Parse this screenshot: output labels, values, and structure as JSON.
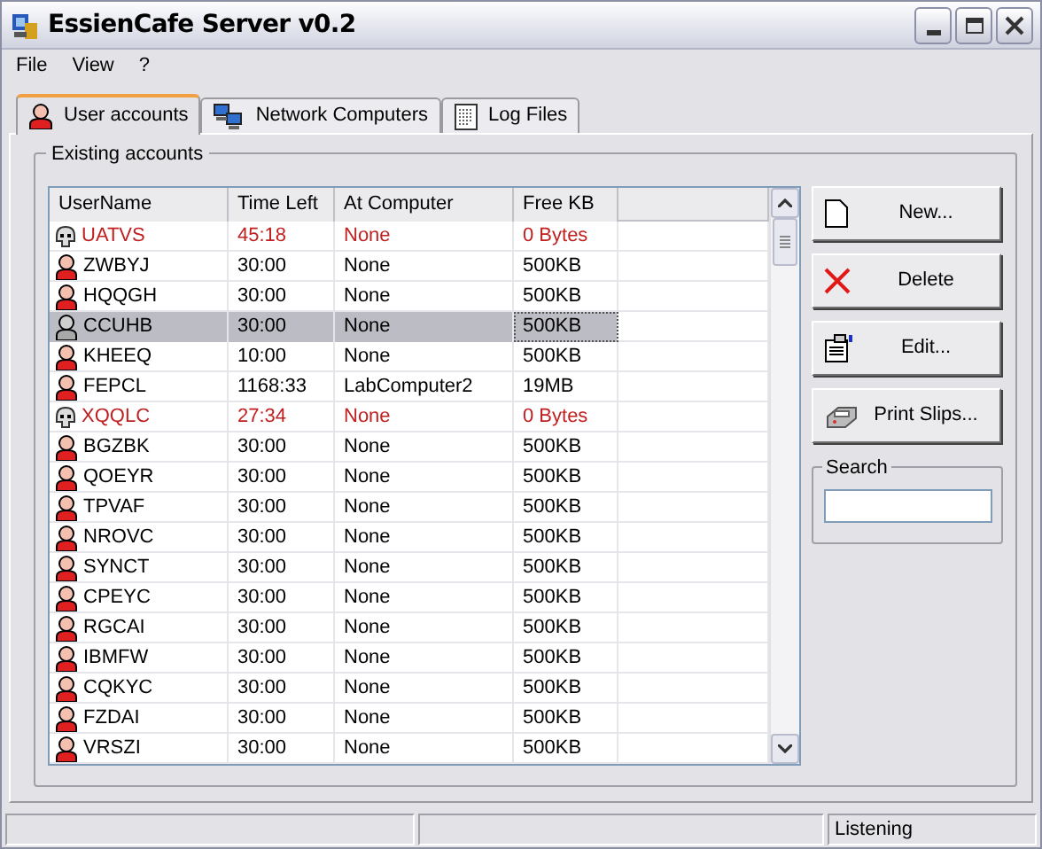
{
  "window": {
    "title": "EssienCafe Server v0.2"
  },
  "menu": [
    "File",
    "View",
    "?"
  ],
  "tabs": [
    {
      "label": "User accounts",
      "selected": true
    },
    {
      "label": "Network Computers",
      "selected": false
    },
    {
      "label": "Log Files",
      "selected": false
    }
  ],
  "group": {
    "title": "Existing accounts"
  },
  "table": {
    "columns": [
      "UserName",
      "Time Left",
      "At Computer",
      "Free KB"
    ],
    "rows": [
      {
        "kind": "expired",
        "selected": false,
        "cells": [
          "UATVS",
          "45:18",
          "None",
          "0 Bytes"
        ]
      },
      {
        "kind": "active",
        "selected": false,
        "cells": [
          "ZWBYJ",
          "30:00",
          "None",
          "500KB"
        ]
      },
      {
        "kind": "active",
        "selected": false,
        "cells": [
          "HQQGH",
          "30:00",
          "None",
          "500KB"
        ]
      },
      {
        "kind": "active",
        "selected": true,
        "cells": [
          "CCUHB",
          "30:00",
          "None",
          "500KB"
        ]
      },
      {
        "kind": "active",
        "selected": false,
        "cells": [
          "KHEEQ",
          "10:00",
          "None",
          "500KB"
        ]
      },
      {
        "kind": "active",
        "selected": false,
        "cells": [
          "FEPCL",
          "1168:33",
          "LabComputer2",
          "19MB"
        ]
      },
      {
        "kind": "expired",
        "selected": false,
        "cells": [
          "XQQLC",
          "27:34",
          "None",
          "0 Bytes"
        ]
      },
      {
        "kind": "active",
        "selected": false,
        "cells": [
          "BGZBK",
          "30:00",
          "None",
          "500KB"
        ]
      },
      {
        "kind": "active",
        "selected": false,
        "cells": [
          "QOEYR",
          "30:00",
          "None",
          "500KB"
        ]
      },
      {
        "kind": "active",
        "selected": false,
        "cells": [
          "TPVAF",
          "30:00",
          "None",
          "500KB"
        ]
      },
      {
        "kind": "active",
        "selected": false,
        "cells": [
          "NROVC",
          "30:00",
          "None",
          "500KB"
        ]
      },
      {
        "kind": "active",
        "selected": false,
        "cells": [
          "SYNCT",
          "30:00",
          "None",
          "500KB"
        ]
      },
      {
        "kind": "active",
        "selected": false,
        "cells": [
          "CPEYC",
          "30:00",
          "None",
          "500KB"
        ]
      },
      {
        "kind": "active",
        "selected": false,
        "cells": [
          "RGCAI",
          "30:00",
          "None",
          "500KB"
        ]
      },
      {
        "kind": "active",
        "selected": false,
        "cells": [
          "IBMFW",
          "30:00",
          "None",
          "500KB"
        ]
      },
      {
        "kind": "active",
        "selected": false,
        "cells": [
          "CQKYC",
          "30:00",
          "None",
          "500KB"
        ]
      },
      {
        "kind": "active",
        "selected": false,
        "cells": [
          "FZDAI",
          "30:00",
          "None",
          "500KB"
        ]
      },
      {
        "kind": "active",
        "selected": false,
        "cells": [
          "VRSZI",
          "30:00",
          "None",
          "500KB"
        ]
      }
    ]
  },
  "buttons": [
    {
      "label": "New..."
    },
    {
      "label": "Delete"
    },
    {
      "label": "Edit..."
    },
    {
      "label": "Print Slips..."
    }
  ],
  "search": {
    "label": "Search"
  },
  "status_bar": {
    "status": "Listening"
  }
}
